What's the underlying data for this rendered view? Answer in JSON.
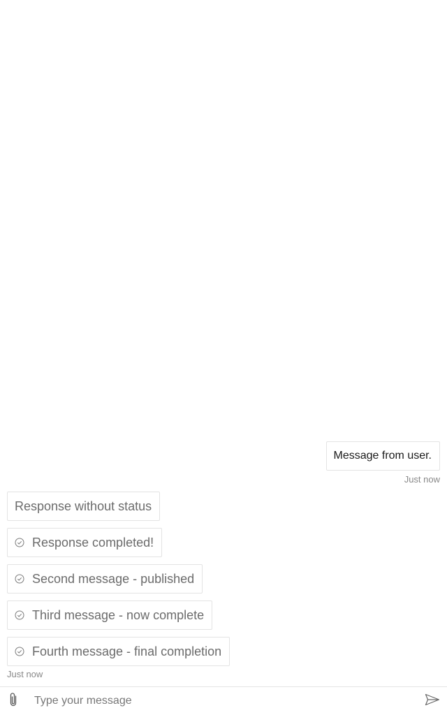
{
  "conversation": {
    "user_message": {
      "text": "Message from user.",
      "timestamp": "Just now"
    },
    "bot_messages": [
      {
        "text": "Response without status",
        "status": "none"
      },
      {
        "text": "Response completed!",
        "status": "check-circle-icon"
      },
      {
        "text": "Second message - published",
        "status": "check-circle-icon"
      },
      {
        "text": "Third message - now complete",
        "status": "check-circle-icon"
      },
      {
        "text": "Fourth message - final completion",
        "status": "check-circle-icon"
      }
    ],
    "bot_timestamp": "Just now"
  },
  "composer": {
    "placeholder": "Type your message",
    "value": "",
    "attach_icon": "paperclip-icon",
    "send_icon": "send-icon"
  },
  "colors": {
    "bubble_border": "#e3e3e3",
    "bot_text": "#6b6b6b",
    "user_text": "#1a1a1a",
    "timestamp": "#888888"
  }
}
